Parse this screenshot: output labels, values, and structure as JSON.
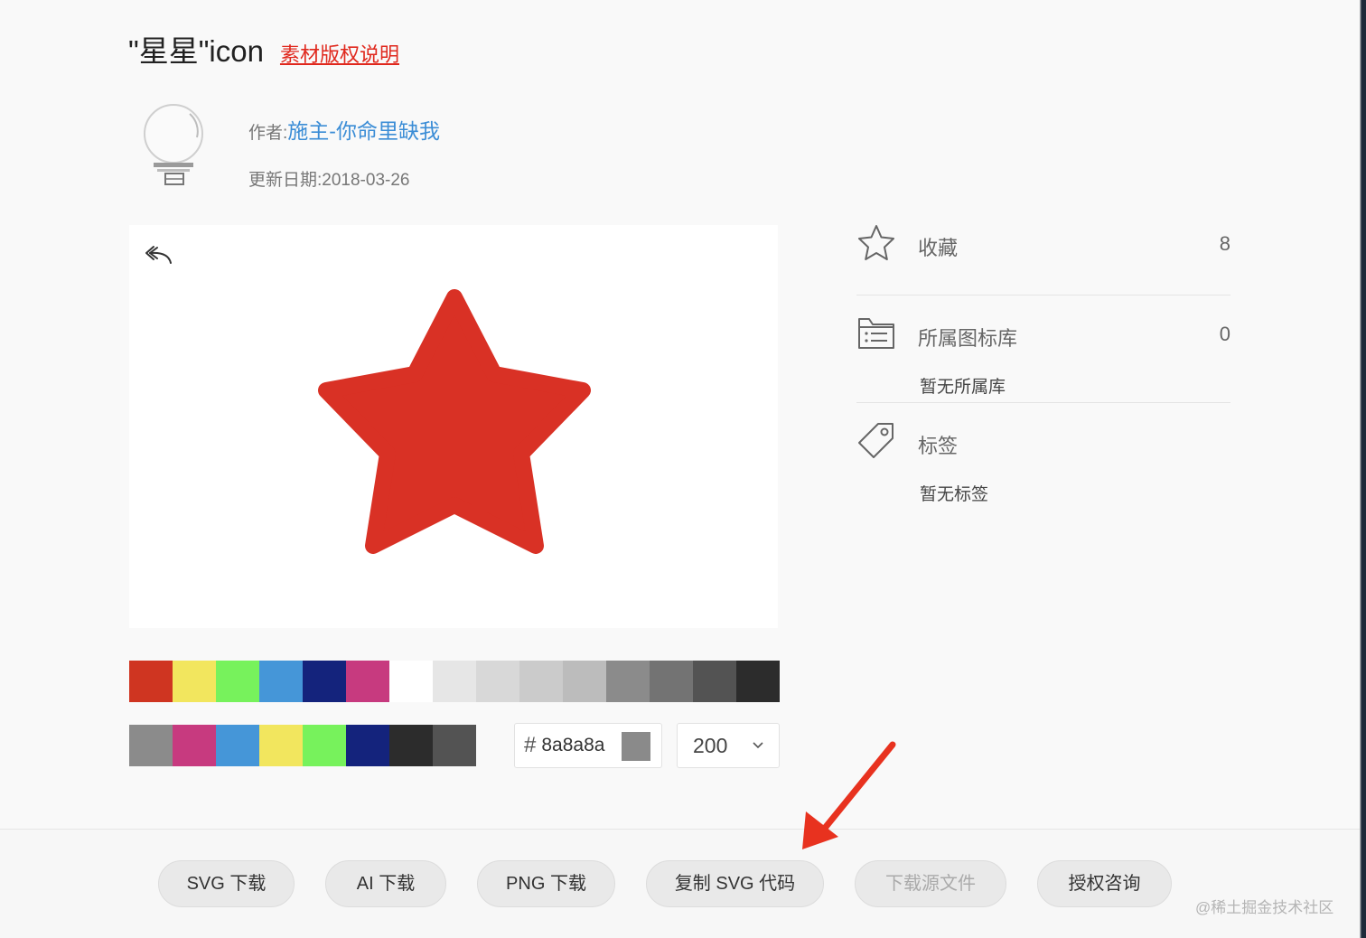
{
  "header": {
    "title": "\"星星\"icon",
    "license_link": "素材版权说明"
  },
  "author": {
    "label": "作者:",
    "name": "施主-你命里缺我",
    "date_label": "更新日期:",
    "date": "2018-03-26"
  },
  "preview": {
    "icon_color": "#d93125"
  },
  "palette": {
    "row1": [
      "#cf3521",
      "#f2e65e",
      "#77f25c",
      "#4596d8",
      "#14237c",
      "#c73a7f",
      "#ffffff",
      "#e6e6e6",
      "#d8d8d8",
      "#cbcbcb",
      "#bcbcbc",
      "#8b8b8b",
      "#737373",
      "#535353",
      "#2c2c2c"
    ],
    "row2": [
      "#8b8b8b",
      "#c73a7f",
      "#4596d8",
      "#f2e65e",
      "#77f25c",
      "#14237c",
      "#2c2c2c",
      "#535353"
    ]
  },
  "color_input": {
    "hash": "#",
    "value": "8a8a8a",
    "swatch": "#8a8a8a"
  },
  "size_select": {
    "value": "200"
  },
  "sidebar": {
    "favorite": {
      "label": "收藏",
      "count": "8"
    },
    "library": {
      "label": "所属图标库",
      "count": "0",
      "empty": "暂无所属库"
    },
    "tags": {
      "label": "标签",
      "empty": "暂无标签"
    }
  },
  "buttons": {
    "svg_download": "SVG 下载",
    "ai_download": "AI 下载",
    "png_download": "PNG 下载",
    "copy_svg": "复制 SVG 代码",
    "download_source": "下载源文件",
    "license_consult": "授权咨询"
  },
  "watermark": "@稀土掘金技术社区",
  "colors": {
    "accent_link": "#3b8dd6",
    "warning_red": "#e0281d",
    "arrow": "#e8321f"
  }
}
